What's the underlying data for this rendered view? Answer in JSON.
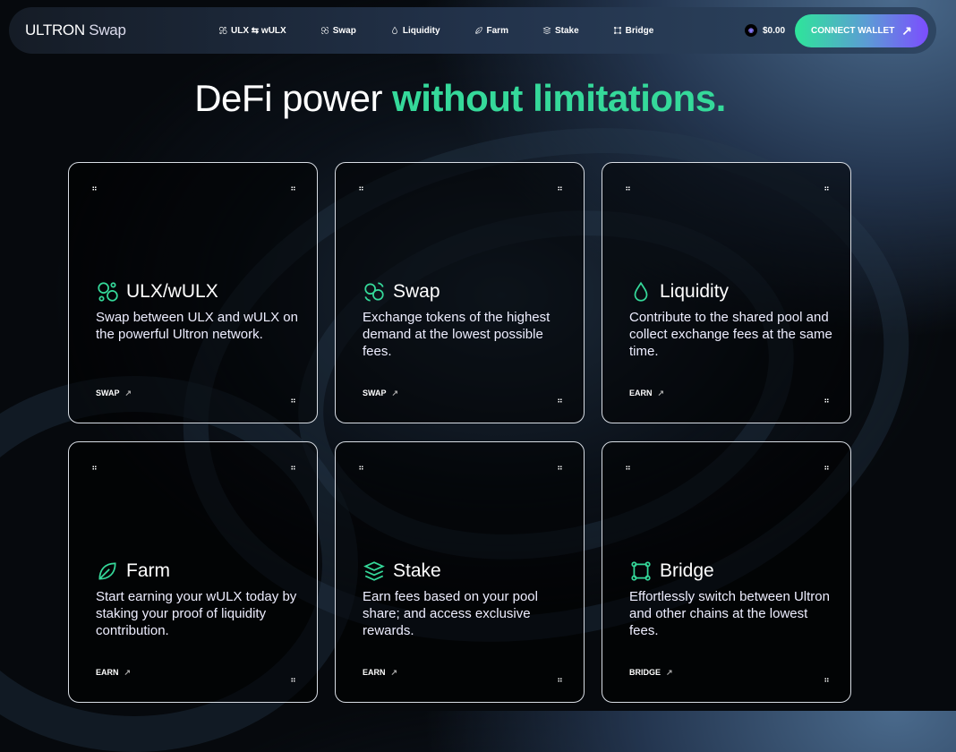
{
  "header": {
    "logo_bold": "ULTRON",
    "logo_light": "Swap",
    "nav": [
      {
        "label": "ULX ⇆ wULX",
        "icon": "ulx-icon"
      },
      {
        "label": "Swap",
        "icon": "swap-icon"
      },
      {
        "label": "Liquidity",
        "icon": "drop-icon"
      },
      {
        "label": "Farm",
        "icon": "leaf-icon"
      },
      {
        "label": "Stake",
        "icon": "stack-icon"
      },
      {
        "label": "Bridge",
        "icon": "bridge-icon"
      }
    ],
    "balance": "$0.00",
    "connect": "CONNECT WALLET"
  },
  "hero": {
    "title_a": "DeFi power ",
    "title_b": "without limitations."
  },
  "cards": [
    {
      "title": "ULX/wULX",
      "desc": "Swap between ULX and wULX on the powerful Ultron network.",
      "link": "SWAP"
    },
    {
      "title": "Swap",
      "desc": "Exchange tokens of the highest demand at the lowest possible fees.",
      "link": "SWAP"
    },
    {
      "title": "Liquidity",
      "desc": "Contribute to the shared pool and collect exchange fees at the same time.",
      "link": "EARN"
    },
    {
      "title": "Farm",
      "desc": "Start earning your wULX today by staking your proof of liquidity contribution.",
      "link": "EARN"
    },
    {
      "title": "Stake",
      "desc": "Earn fees based on your pool share; and access exclusive rewards.",
      "link": "EARN"
    },
    {
      "title": "Bridge",
      "desc": "Effortlessly switch between Ultron and other chains at the lowest fees.",
      "link": "BRIDGE"
    }
  ],
  "colors": {
    "accent": "#35d99a",
    "gradient_end": "#7c4dff"
  }
}
